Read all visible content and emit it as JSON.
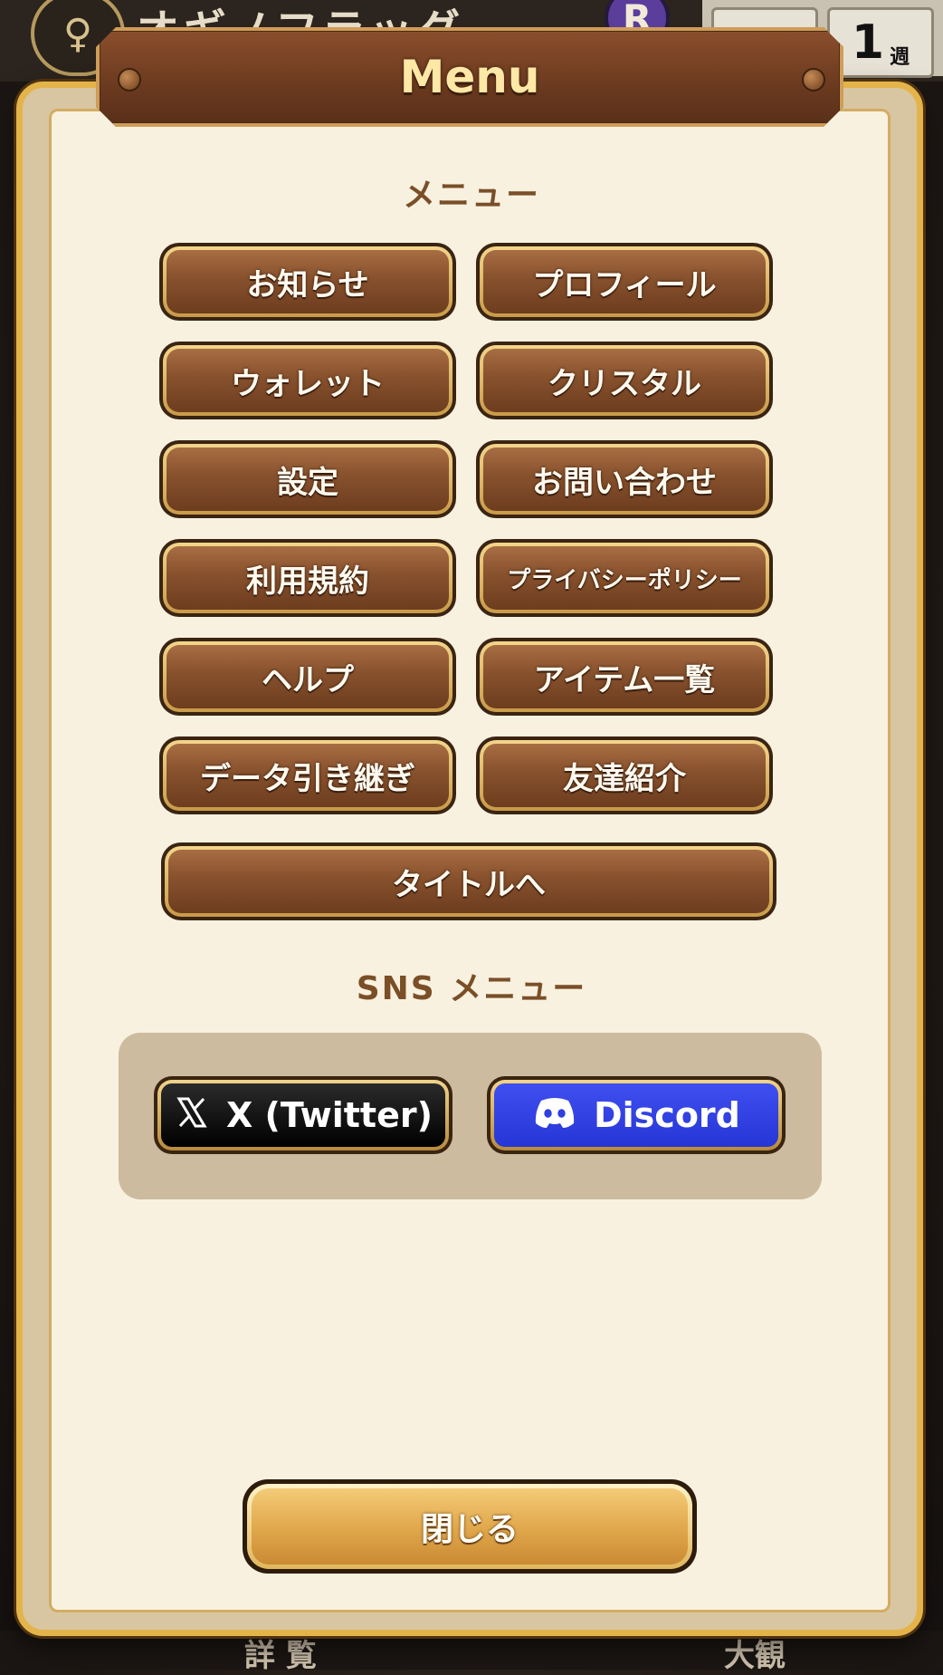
{
  "background": {
    "gender_symbol": "♀",
    "player_name": "オギノフラッグ",
    "rank_badge": "R",
    "counter_week_value": "1",
    "counter_week_unit": "週",
    "bottom_tab_left": "詳 覧",
    "bottom_tab_right": "大観"
  },
  "header": {
    "title": "Menu"
  },
  "menu_section": {
    "label": "メニュー",
    "items": [
      {
        "label": "お知らせ"
      },
      {
        "label": "プロフィール"
      },
      {
        "label": "ウォレット"
      },
      {
        "label": "クリスタル"
      },
      {
        "label": "設定"
      },
      {
        "label": "お問い合わせ"
      },
      {
        "label": "利用規約"
      },
      {
        "label": "プライバシーポリシー"
      },
      {
        "label": "ヘルプ"
      },
      {
        "label": "アイテム一覧"
      },
      {
        "label": "データ引き継ぎ"
      },
      {
        "label": "友達紹介"
      }
    ],
    "title_button": "タイトルへ"
  },
  "sns_section": {
    "label": "SNS メニュー",
    "twitter": {
      "label": "X (Twitter)",
      "icon": "x-logo-icon"
    },
    "discord": {
      "label": "Discord",
      "icon": "discord-logo-icon"
    }
  },
  "footer": {
    "close_label": "閉じる"
  },
  "colors": {
    "frame_gold": "#e4b44a",
    "panel_cream": "#f8f1e0",
    "button_brown": "#87512d",
    "discord_blue": "#3f4ff0",
    "section_label": "#7a4f27"
  }
}
